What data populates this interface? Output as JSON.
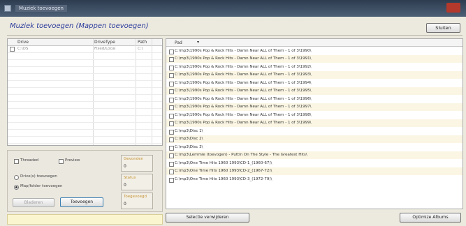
{
  "window": {
    "title": "Muziek toevoegen"
  },
  "heading": "Muziek toevoegen (Mappen toevoegen)",
  "close_button": "Sluiten",
  "drive_table": {
    "columns": [
      "Drive",
      "DriveType",
      "Path"
    ],
    "rows": [
      {
        "drive": "C:\\OS",
        "type": "Fixed/Local",
        "path": "C:\\"
      }
    ]
  },
  "options": {
    "threaded": "Threaded",
    "preview": "Preview",
    "drives_label": "Drive(s) toevoegen",
    "map_folder_label": "Map/folder toevoegen",
    "browse": "Bladeren",
    "add": "Toevoegen"
  },
  "stats": [
    {
      "label": "Gevonden",
      "value": "0"
    },
    {
      "label": "Status",
      "value": "0"
    },
    {
      "label": "Toegevoegd",
      "value": "0"
    }
  ],
  "path_list": {
    "header": "Pad",
    "items": [
      "C:\\mp3\\1990s Pop & Rock Hits - Damn Near ALL of Them - 1 of 3\\1990\\",
      "C:\\mp3\\1990s Pop & Rock Hits - Damn Near ALL of Them - 1 of 3\\1991\\",
      "C:\\mp3\\1990s Pop & Rock Hits - Damn Near ALL of Them - 1 of 3\\1992\\",
      "C:\\mp3\\1990s Pop & Rock Hits - Damn Near ALL of Them - 1 of 3\\1993\\",
      "C:\\mp3\\1990s Pop & Rock Hits - Damn Near ALL of Them - 1 of 3\\1994\\",
      "C:\\mp3\\1990s Pop & Rock Hits - Damn Near ALL of Them - 1 of 3\\1995\\",
      "C:\\mp3\\1990s Pop & Rock Hits - Damn Near ALL of Them - 1 of 3\\1996\\",
      "C:\\mp3\\1990s Pop & Rock Hits - Damn Near ALL of Them - 1 of 3\\1997\\",
      "C:\\mp3\\1990s Pop & Rock Hits - Damn Near ALL of Them - 1 of 3\\1998\\",
      "C:\\mp3\\1990s Pop & Rock Hits - Damn Near ALL of Them - 1 of 3\\1999\\",
      "C:\\mp3\\Disc 1\\",
      "C:\\mp3\\Disc 2\\",
      "C:\\mp3\\Disc 3\\",
      "C:\\mp3\\Lemmie (toevogen) - Puttin On The Style - The Greatest Hits\\",
      "C:\\mp3\\One Time Hits 1960 1993\\CD-1_(1960-67)\\",
      "C:\\mp3\\One Time Hits 1960 1993\\CD-2_(1967-72)\\",
      "C:\\mp3\\One Time Hits 1960 1993\\CD-3_(1972-79)\\"
    ]
  },
  "bottom_buttons": {
    "remove_selection": "Selectie verwijderen",
    "optimize": "Optimize Albums"
  },
  "status_bar": ""
}
